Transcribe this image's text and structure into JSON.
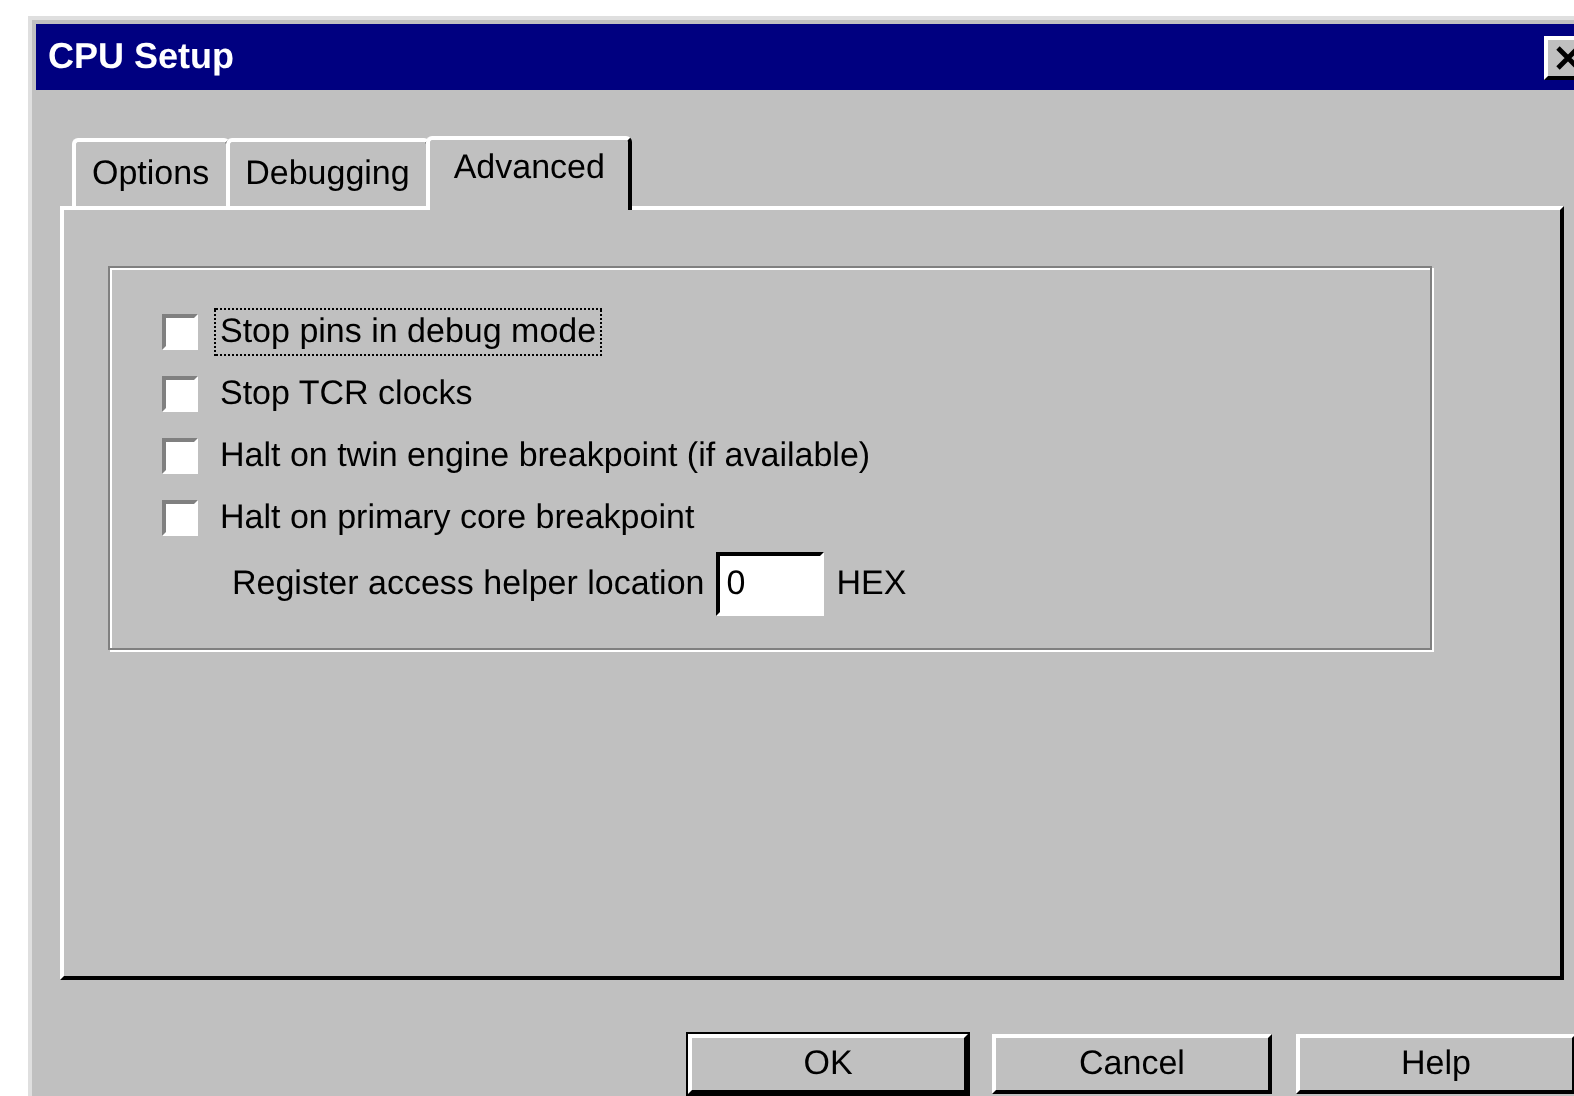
{
  "window": {
    "title": "CPU Setup"
  },
  "tabs": [
    {
      "label": "Options",
      "selected": false
    },
    {
      "label": "Debugging",
      "selected": false
    },
    {
      "label": "Advanced",
      "selected": true
    }
  ],
  "options": [
    {
      "label": "Stop pins in debug mode",
      "checked": false,
      "focused": true
    },
    {
      "label": "Stop TCR clocks",
      "checked": false,
      "focused": false
    },
    {
      "label": "Halt on twin engine breakpoint (if available)",
      "checked": false,
      "focused": false
    },
    {
      "label": "Halt on primary core breakpoint",
      "checked": false,
      "focused": false
    }
  ],
  "register_field": {
    "label": "Register access helper location",
    "value": "0",
    "unit": "HEX"
  },
  "buttons": [
    {
      "label": "OK",
      "default": true
    },
    {
      "label": "Cancel",
      "default": false
    },
    {
      "label": "Help",
      "default": false
    }
  ]
}
